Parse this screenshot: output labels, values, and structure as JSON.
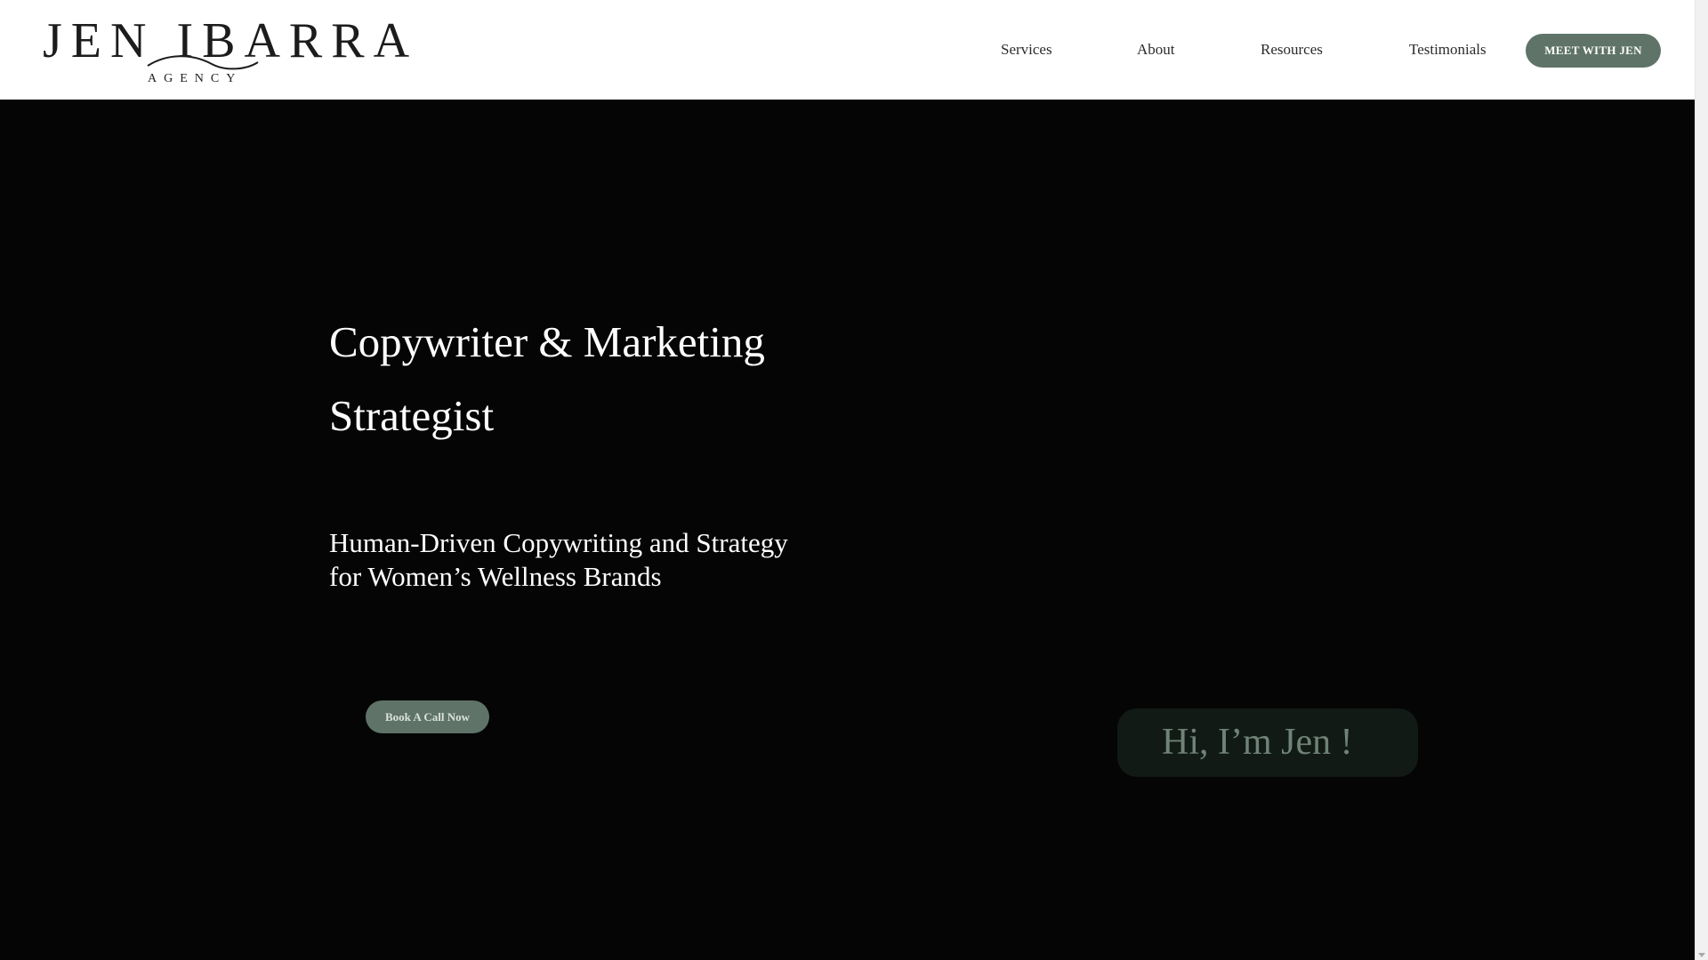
{
  "header": {
    "logo": {
      "main": "JEN IBARRA",
      "sub": "AGENCY"
    },
    "nav": [
      {
        "label": "Services"
      },
      {
        "label": "About"
      },
      {
        "label": "Resources"
      },
      {
        "label": "Testimonials"
      }
    ],
    "cta_label": "MEET WITH JEN"
  },
  "hero": {
    "title": "Copywriter & Marketing Strategist",
    "subtitle": "Human-Driven Copywriting and Strategy for Women’s Wellness Brands",
    "cta_label": "Book A Call Now",
    "greeting": "Hi, I’m Jen !"
  },
  "colors": {
    "background": "#050505",
    "header_background": "#ffffff",
    "accent_green": "#5f7368",
    "greeting_box": "#121a15",
    "greeting_text": "#6f8378"
  },
  "icons": {
    "scroll_down": "chevron-down-icon",
    "logo_swoosh": "logo-swoosh-icon"
  }
}
